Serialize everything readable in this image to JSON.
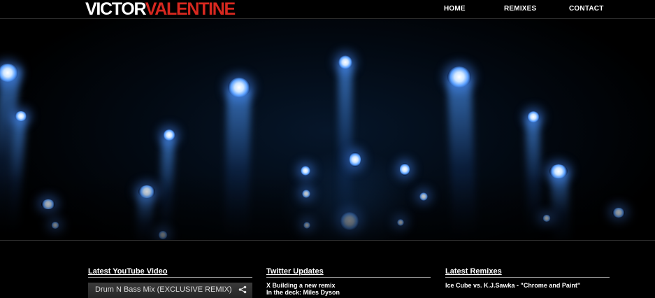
{
  "header": {
    "logo_first": "VICTOR",
    "logo_last": "VALENTINE",
    "nav": [
      "HOME",
      "REMIXES",
      "CONTACT"
    ]
  },
  "hero": {
    "icon": "concert-spotlights-image"
  },
  "sections": {
    "youtube": {
      "heading": "Latest YouTube Video",
      "video_title": "Drum N Bass Mix (EXCLUSIVE REMIX)",
      "share_icon": "share-icon"
    },
    "twitter": {
      "heading": "Twitter Updates",
      "tweets": [
        "X Building a new remix",
        "In the deck: Miles Dyson"
      ]
    },
    "remixes": {
      "heading": "Latest Remixes",
      "items": [
        "Ice Cube vs. K.J.Sawka - \"Chrome and Paint\""
      ]
    }
  },
  "colors": {
    "background": "#000000",
    "logo_accent": "#d8281f",
    "text": "#ffffff",
    "stage_light": "#5aa0ff"
  }
}
